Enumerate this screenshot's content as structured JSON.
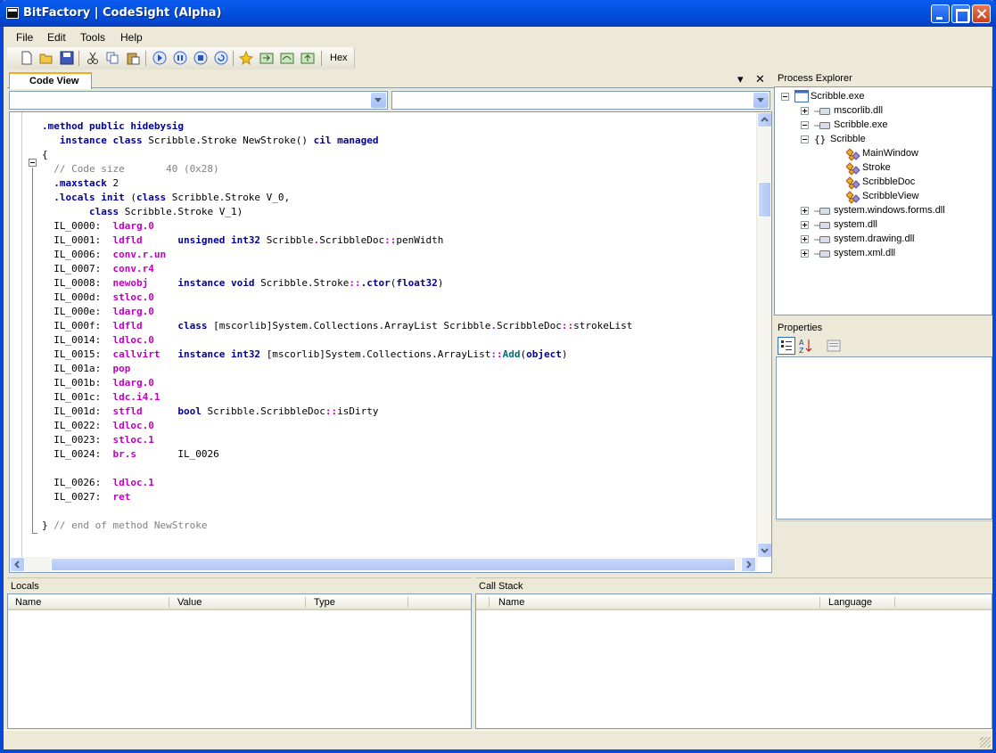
{
  "window": {
    "title": "BitFactory | CodeSight (Alpha)"
  },
  "menu": [
    "File",
    "Edit",
    "Tools",
    "Help"
  ],
  "toolbar": {
    "icons": [
      "new-file-icon",
      "open-folder-icon",
      "save-icon",
      "cut-icon",
      "copy-icon",
      "paste-icon",
      "run-icon",
      "pause-icon",
      "stop-icon",
      "restart-icon",
      "highlight-icon",
      "step-into-icon",
      "step-over-icon",
      "step-out-icon"
    ],
    "hex_label": "Hex"
  },
  "code_view": {
    "tab_label": "Code View",
    "lines": [
      [
        [
          "k",
          ".method public hidebysig"
        ]
      ],
      [
        [
          "n",
          "   "
        ],
        [
          "k",
          "instance class "
        ],
        [
          "n",
          "Scribble.Stroke NewStroke() "
        ],
        [
          "k",
          "cil managed"
        ]
      ],
      [
        [
          "n",
          "{"
        ]
      ],
      [
        [
          "c",
          "  // Code size       40 (0x28)"
        ]
      ],
      [
        [
          "k",
          "  .maxstack "
        ],
        [
          "n",
          "2"
        ]
      ],
      [
        [
          "k",
          "  .locals init "
        ],
        [
          "n",
          "("
        ],
        [
          "k",
          "class "
        ],
        [
          "n",
          "Scribble.Stroke V_0,"
        ]
      ],
      [
        [
          "n",
          "        "
        ],
        [
          "k",
          "class "
        ],
        [
          "n",
          "Scribble.Stroke V_1)"
        ]
      ],
      [
        [
          "n",
          "  IL_0000:  "
        ],
        [
          "o",
          "ldarg.0"
        ]
      ],
      [
        [
          "n",
          "  IL_0001:  "
        ],
        [
          "o",
          "ldfld      "
        ],
        [
          "k",
          "unsigned int32 "
        ],
        [
          "n",
          "Scribble"
        ],
        [
          "o",
          "."
        ],
        [
          "n",
          "ScribbleDoc"
        ],
        [
          "o",
          "::"
        ],
        [
          "n",
          "penWidth"
        ]
      ],
      [
        [
          "n",
          "  IL_0006:  "
        ],
        [
          "o",
          "conv.r.un"
        ]
      ],
      [
        [
          "n",
          "  IL_0007:  "
        ],
        [
          "o",
          "conv.r4"
        ]
      ],
      [
        [
          "n",
          "  IL_0008:  "
        ],
        [
          "o",
          "newobj     "
        ],
        [
          "k",
          "instance void "
        ],
        [
          "n",
          "Scribble.Stroke"
        ],
        [
          "o",
          "::"
        ],
        [
          "k",
          ".ctor"
        ],
        [
          "n",
          "("
        ],
        [
          "k",
          "float32"
        ],
        [
          "n",
          ")"
        ]
      ],
      [
        [
          "n",
          "  IL_000d:  "
        ],
        [
          "o",
          "stloc.0"
        ]
      ],
      [
        [
          "n",
          "  IL_000e:  "
        ],
        [
          "o",
          "ldarg.0"
        ]
      ],
      [
        [
          "n",
          "  IL_000f:  "
        ],
        [
          "o",
          "ldfld      "
        ],
        [
          "k",
          "class "
        ],
        [
          "n",
          "[mscorlib]System.Collections.ArrayList Scribble"
        ],
        [
          "o",
          "."
        ],
        [
          "n",
          "ScribbleDoc"
        ],
        [
          "o",
          "::"
        ],
        [
          "n",
          "strokeList"
        ]
      ],
      [
        [
          "n",
          "  IL_0014:  "
        ],
        [
          "o",
          "ldloc.0"
        ]
      ],
      [
        [
          "n",
          "  IL_0015:  "
        ],
        [
          "o",
          "callvirt   "
        ],
        [
          "k",
          "instance int32 "
        ],
        [
          "n",
          "[mscorlib]System.Collections.ArrayList"
        ],
        [
          "o",
          "::"
        ],
        [
          "f",
          "Add"
        ],
        [
          "n",
          "("
        ],
        [
          "k",
          "object"
        ],
        [
          "n",
          ")"
        ]
      ],
      [
        [
          "n",
          "  IL_001a:  "
        ],
        [
          "o",
          "pop"
        ]
      ],
      [
        [
          "n",
          "  IL_001b:  "
        ],
        [
          "o",
          "ldarg.0"
        ]
      ],
      [
        [
          "n",
          "  IL_001c:  "
        ],
        [
          "o",
          "ldc.i4.1"
        ]
      ],
      [
        [
          "n",
          "  IL_001d:  "
        ],
        [
          "o",
          "stfld      "
        ],
        [
          "k",
          "bool "
        ],
        [
          "n",
          "Scribble.ScribbleDoc"
        ],
        [
          "o",
          "::"
        ],
        [
          "n",
          "isDirty"
        ]
      ],
      [
        [
          "n",
          "  IL_0022:  "
        ],
        [
          "o",
          "ldloc.0"
        ]
      ],
      [
        [
          "n",
          "  IL_0023:  "
        ],
        [
          "o",
          "stloc.1"
        ]
      ],
      [
        [
          "n",
          "  IL_0024:  "
        ],
        [
          "o",
          "br.s       "
        ],
        [
          "n",
          "IL_0026"
        ]
      ],
      [
        [
          "n",
          ""
        ]
      ],
      [
        [
          "n",
          "  IL_0026:  "
        ],
        [
          "o",
          "ldloc.1"
        ]
      ],
      [
        [
          "n",
          "  IL_0027:  "
        ],
        [
          "o",
          "ret"
        ]
      ],
      [
        [
          "n",
          ""
        ]
      ],
      [
        [
          "n",
          "} "
        ],
        [
          "c",
          "// end of method NewStroke"
        ]
      ]
    ]
  },
  "process_explorer": {
    "title": "Process Explorer",
    "tree": [
      {
        "label": "Scribble.exe",
        "level": 0,
        "expander": "minus",
        "icon": "window-icon"
      },
      {
        "label": "mscorlib.dll",
        "level": 1,
        "expander": "plus",
        "icon": "assembly-icon"
      },
      {
        "label": "Scribble.exe",
        "level": 1,
        "expander": "minus",
        "icon": "assembly-icon"
      },
      {
        "label": "Scribble",
        "level": 2,
        "expander": "minus",
        "icon": "namespace-icon"
      },
      {
        "label": "MainWindow",
        "level": 3,
        "expander": "",
        "icon": "class-icon"
      },
      {
        "label": "Stroke",
        "level": 3,
        "expander": "",
        "icon": "class-icon"
      },
      {
        "label": "ScribbleDoc",
        "level": 3,
        "expander": "",
        "icon": "class-icon"
      },
      {
        "label": "ScribbleView",
        "level": 3,
        "expander": "",
        "icon": "class-icon"
      },
      {
        "label": "system.windows.forms.dll",
        "level": 1,
        "expander": "plus",
        "icon": "assembly-icon"
      },
      {
        "label": "system.dll",
        "level": 1,
        "expander": "plus",
        "icon": "assembly-icon"
      },
      {
        "label": "system.drawing.dll",
        "level": 1,
        "expander": "plus",
        "icon": "assembly-icon"
      },
      {
        "label": "system.xml.dll",
        "level": 1,
        "expander": "plus",
        "icon": "assembly-icon"
      }
    ]
  },
  "properties": {
    "title": "Properties"
  },
  "locals": {
    "title": "Locals",
    "columns": [
      "Name",
      "Value",
      "Type"
    ]
  },
  "call_stack": {
    "title": "Call Stack",
    "columns": [
      "Name",
      "Language"
    ]
  }
}
